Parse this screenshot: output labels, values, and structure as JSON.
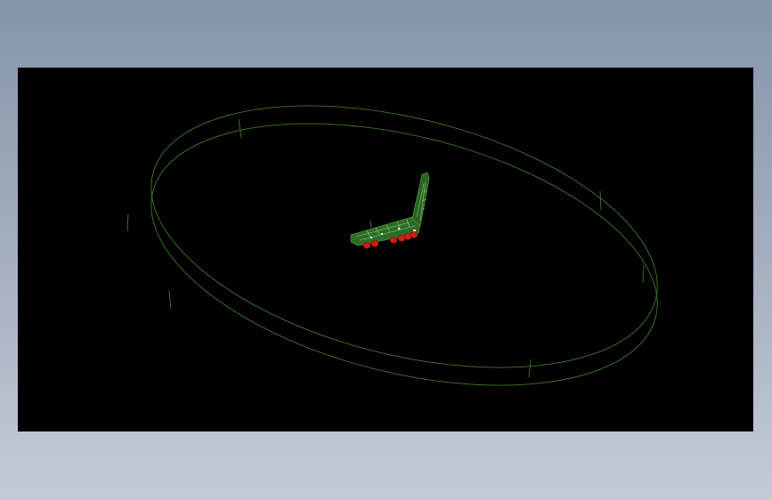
{
  "viewport": {
    "background_color": "#000000",
    "outer_gradient_top": "#8594aa",
    "outer_gradient_bottom": "#c5cad6"
  },
  "scene": {
    "ring_color": "#3f7a2a",
    "ring_edge_color": "#4e9636",
    "model_body_color": "#2e6a28",
    "model_highlight_color": "#8fd07a",
    "wheel_color": "#d01f10",
    "wheel_count": 6,
    "icons": [
      "circular-track-ring",
      "crane-vehicle-model",
      "wheel"
    ]
  }
}
